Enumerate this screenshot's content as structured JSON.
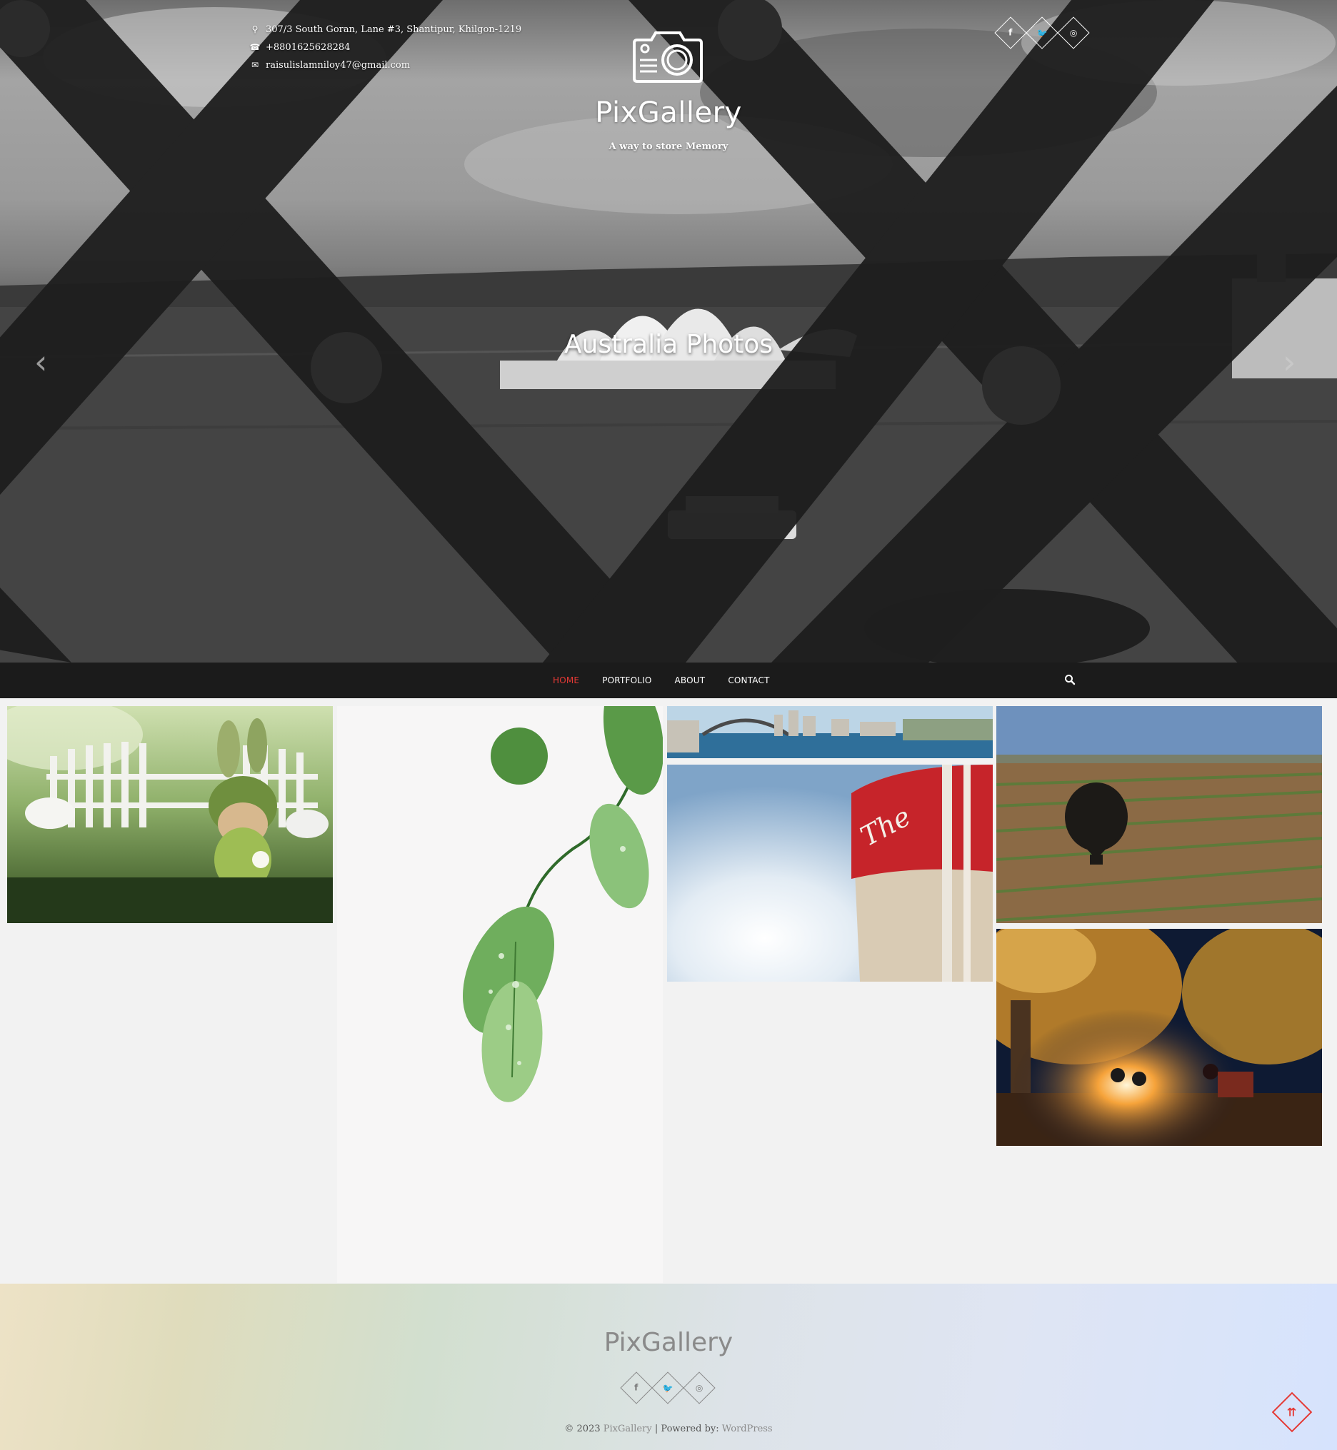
{
  "header": {
    "address": "307/3 South Goran, Lane #3, Shantipur, Khilgon-1219",
    "phone": "+8801625628284",
    "email": "raisulislamniloy47@gmail.com",
    "site_title": "PixGallery",
    "tagline": "A way to store Memory",
    "social": [
      {
        "name": "facebook",
        "glyph": "f"
      },
      {
        "name": "twitter",
        "glyph": "🐦"
      },
      {
        "name": "instagram",
        "glyph": "◎"
      }
    ]
  },
  "slider": {
    "caption": "Australia Photos",
    "prev_glyph": "‹",
    "next_glyph": "›"
  },
  "nav": {
    "items": [
      "HOME",
      "PORTFOLIO",
      "ABOUT",
      "CONTACT"
    ],
    "active": "HOME"
  },
  "gallery": {
    "items": [
      {
        "name": "bunny-toy-photo"
      },
      {
        "name": "leaf-drops-photo"
      },
      {
        "name": "sydney-skyline-photo"
      },
      {
        "name": "water-tower-photo"
      },
      {
        "name": "balloon-shadow-field-photo"
      },
      {
        "name": "campfire-night-photo"
      }
    ]
  },
  "footer": {
    "title": "PixGallery",
    "copyright_prefix": "© 2023 ",
    "site_link": "PixGallery",
    "separator": " | Powered by: ",
    "powered_link": "WordPress"
  },
  "colors": {
    "accent": "#e53935",
    "nav_bg": "#1b1b1b",
    "page_bg": "#f2f2f2"
  },
  "icons": {
    "back_to_top": "⇈"
  }
}
